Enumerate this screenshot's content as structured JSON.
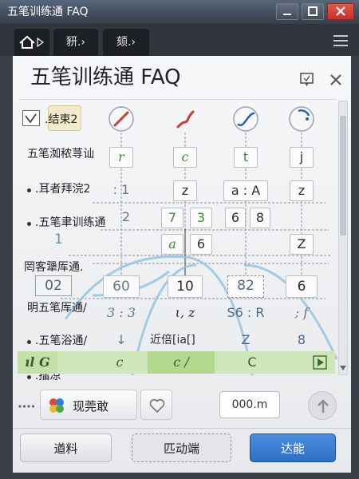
{
  "window": {
    "title": "五笔训练通 FAQ"
  },
  "toolbar": {
    "home_icon": "home-icon",
    "tabs": [
      "豜.›",
      "颏.›"
    ],
    "menu_icon": "hamburger-menu-icon"
  },
  "panel": {
    "title": "五笔训练通 FAQ",
    "pin_icon": "pin-icon",
    "close_icon": "close-icon"
  },
  "list": {
    "checkbox_checked": true,
    "items": [
      ".结束2",
      "五笔洳秾荨讪",
      ".耳者拜浣2",
      ".五笔聿训练通",
      "1",
      "罔客犟厍通.",
      "02",
      "明五笔厍通/",
      ".五笔浴通/",
      ".擂凉"
    ]
  },
  "grid": {
    "stroke_icons": [
      "pen-stroke-icon",
      "squiggle-stroke-icon",
      "wave-stroke-icon",
      "dial-stroke-icon"
    ],
    "letters": [
      "r",
      "c",
      "t",
      "j"
    ],
    "row_2": [
      ": 1",
      "z",
      "a : A",
      "z"
    ],
    "row_3": {
      "col1": "2",
      "col2": [
        "7",
        "3"
      ],
      "col3": [
        "6",
        "8"
      ]
    },
    "row_4": {
      "col2": [
        "a",
        "6"
      ],
      "col4": "Z"
    },
    "row_5": [
      "60",
      "10",
      "82",
      "6"
    ],
    "row_6": [
      "3 : 3",
      "ι, z",
      "S6 : R",
      "; f"
    ],
    "row_7": [
      "↓",
      "近倍[ia[]",
      "Z",
      "8"
    ],
    "highlight_row": [
      "ıl G",
      "c",
      "c /",
      "C"
    ],
    "highlight_icon": "play-icon"
  },
  "bottom_bar": {
    "more_icon": "more-dots-icon",
    "action_icon": "puzzle-icon",
    "action_label": "现莞敢",
    "favorite_icon": "heart-icon",
    "field_value": "000.m",
    "up_icon": "arrow-up-icon"
  },
  "footer": {
    "buttons": [
      "遒料",
      "匹动端",
      "达能"
    ]
  },
  "colors": {
    "accent": "#2f6fc4",
    "close": "#c7312b",
    "highlight": "#cfe7b8",
    "code_green": "#3e8a3a",
    "curve_blue": "#8fc3e0"
  }
}
